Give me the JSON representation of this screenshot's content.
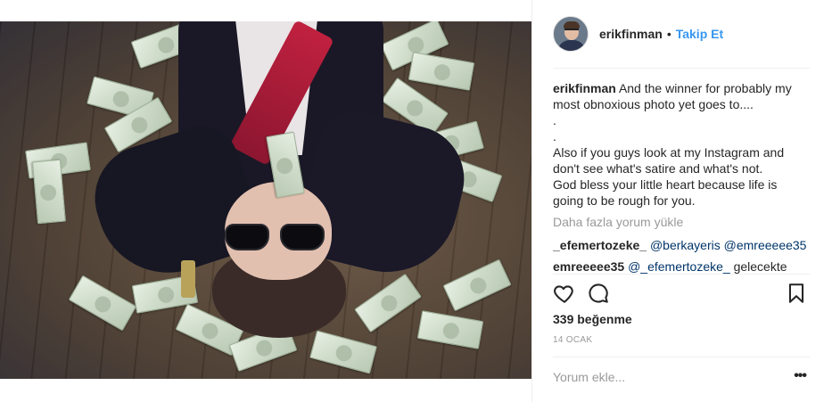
{
  "post": {
    "image_alt": "",
    "author": {
      "username": "erikfinman",
      "separator": "•",
      "follow_label": "Takip Et"
    },
    "caption": {
      "username": "erikfinman",
      "lines": [
        "And the winner for probably my",
        "most obnoxious photo yet goes to....",
        ".",
        ".",
        "Also if you guys look at my Instagram and",
        "don't see what's satire and what's not.",
        "God bless your little heart because life is",
        "going to be rough for you."
      ]
    },
    "load_more_label": "Daha fazla yorum yükle",
    "comments": [
      {
        "username": "_efemertozeke_",
        "mentions": [
          "@berkayeris",
          "@emreeeee35"
        ],
        "text": ""
      },
      {
        "username": "emreeeee35",
        "mentions": [
          "@_efemertozeke_"
        ],
        "text": "gelecekte"
      }
    ],
    "likes_text": "339 beğenme",
    "date_text": "14 OCAK",
    "comment_placeholder": "Yorum ekle...",
    "more_options": "•••",
    "icons": {
      "like": "heart-icon",
      "comment": "comment-bubble-icon",
      "save": "bookmark-icon"
    }
  },
  "colors": {
    "accent": "#3897f0",
    "text": "#262626",
    "muted": "#999999",
    "mention": "#003569",
    "divider": "#efefef"
  }
}
